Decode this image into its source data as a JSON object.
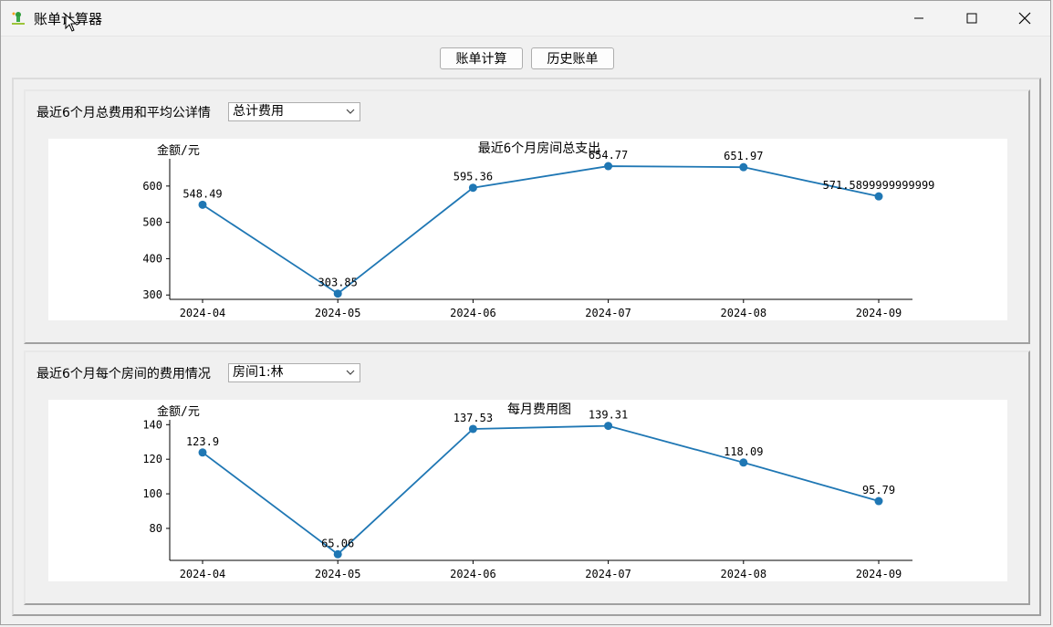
{
  "window": {
    "title": "账单计算器"
  },
  "toolbar": {
    "calc_label": "账单计算",
    "history_label": "历史账单"
  },
  "panel1": {
    "label": "最近6个月总费用和平均公详情",
    "select_value": "总计费用"
  },
  "panel2": {
    "label": "最近6个月每个房间的费用情况",
    "select_value": "房间1:林"
  },
  "colors": {
    "series": "#1f77b4"
  },
  "chart_data": [
    {
      "type": "line",
      "title": "最近6个月房间总支出",
      "xlabel": "",
      "ylabel": "金额/元",
      "categories": [
        "2024-04",
        "2024-05",
        "2024-06",
        "2024-07",
        "2024-08",
        "2024-09"
      ],
      "values": [
        548.49,
        303.85,
        595.36,
        654.77,
        651.97,
        571.59
      ],
      "data_labels": [
        "548.49",
        "303.85",
        "595.36",
        "654.77",
        "651.97",
        "571.5899999999999"
      ],
      "yticks": [
        300,
        400,
        500,
        600
      ],
      "ylim": [
        288,
        675
      ]
    },
    {
      "type": "line",
      "title": "每月费用图",
      "xlabel": "",
      "ylabel": "金额/元",
      "categories": [
        "2024-04",
        "2024-05",
        "2024-06",
        "2024-07",
        "2024-08",
        "2024-09"
      ],
      "values": [
        123.9,
        65.06,
        137.53,
        139.31,
        118.09,
        95.79
      ],
      "data_labels": [
        "123.9",
        "65.06",
        "137.53",
        "139.31",
        "118.09",
        "95.79"
      ],
      "yticks": [
        80,
        100,
        120,
        140
      ],
      "ylim": [
        61.5,
        142.8
      ]
    }
  ]
}
